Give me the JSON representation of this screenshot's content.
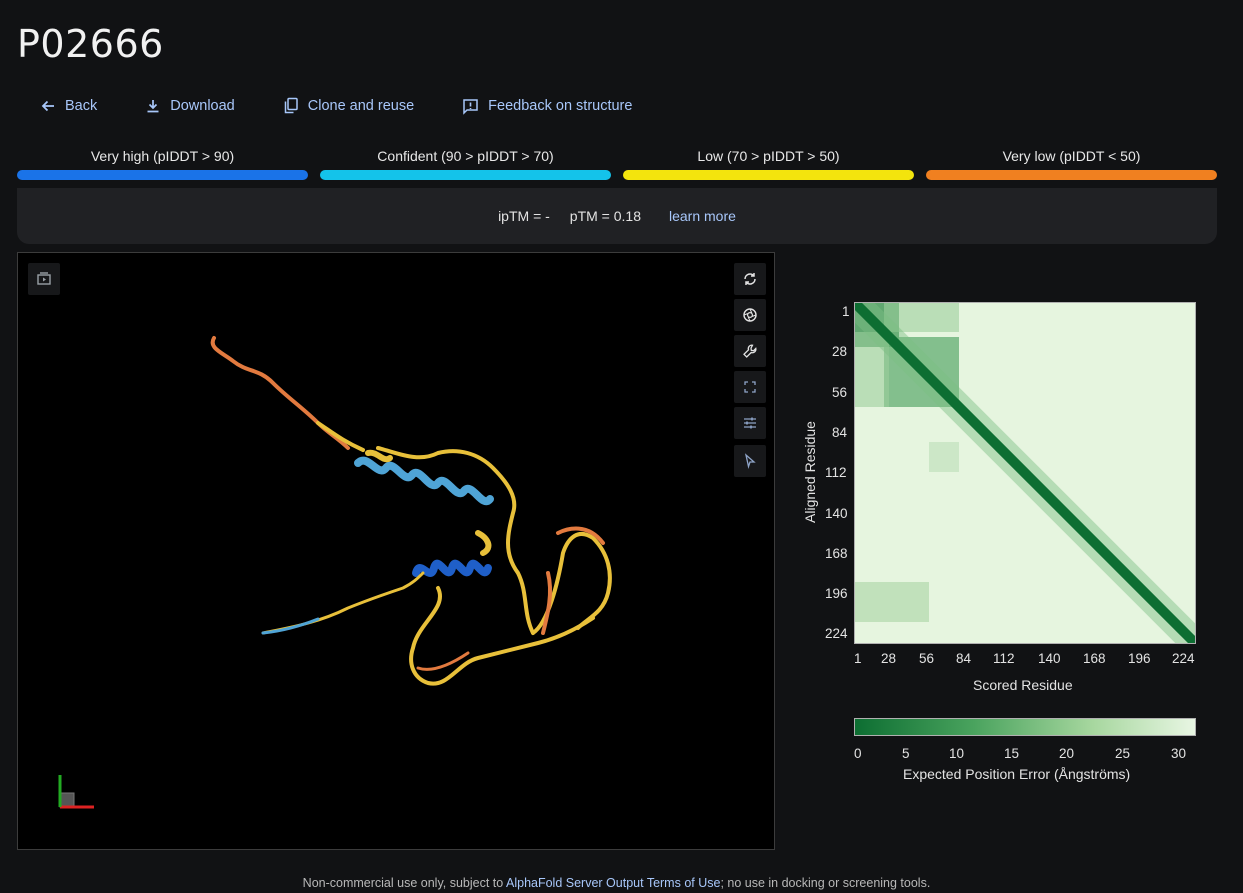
{
  "page": {
    "title": "P02666"
  },
  "actions": {
    "back": "Back",
    "download": "Download",
    "clone": "Clone and reuse",
    "feedback": "Feedback on structure"
  },
  "legend": [
    {
      "label": "Very high (pIDDT > 90)",
      "color": "#1a73e8"
    },
    {
      "label": "Confident (90 > pIDDT > 70)",
      "color": "#14c3ea"
    },
    {
      "label": "Low (70 > pIDDT > 50)",
      "color": "#f3e40d"
    },
    {
      "label": "Very low (pIDDT < 50)",
      "color": "#f08020"
    }
  ],
  "metrics": {
    "iptm": "ipTM = -",
    "ptm": "pTM = 0.18",
    "learn_more": "learn more"
  },
  "viewer": {
    "tools": [
      "rotate-icon",
      "camera-icon",
      "wrench-icon",
      "fullscreen-icon",
      "sliders-icon",
      "pointer-icon"
    ],
    "record_icon": "record-icon"
  },
  "pae": {
    "ylabel": "Aligned Residue",
    "xlabel": "Scored Residue",
    "ticks": [
      "1",
      "28",
      "56",
      "84",
      "112",
      "140",
      "168",
      "196",
      "224"
    ],
    "colorbar_label": "Expected Position Error (Ångströms)",
    "colorbar_ticks": [
      "0",
      "5",
      "10",
      "15",
      "20",
      "25",
      "30"
    ],
    "color_low": "#0d6e32",
    "color_high": "#e8f6e3"
  },
  "footer": {
    "prefix": "Non-commercial use only, subject to ",
    "link": "AlphaFold Server Output Terms of Use",
    "suffix": "; no use in docking or screening tools."
  }
}
